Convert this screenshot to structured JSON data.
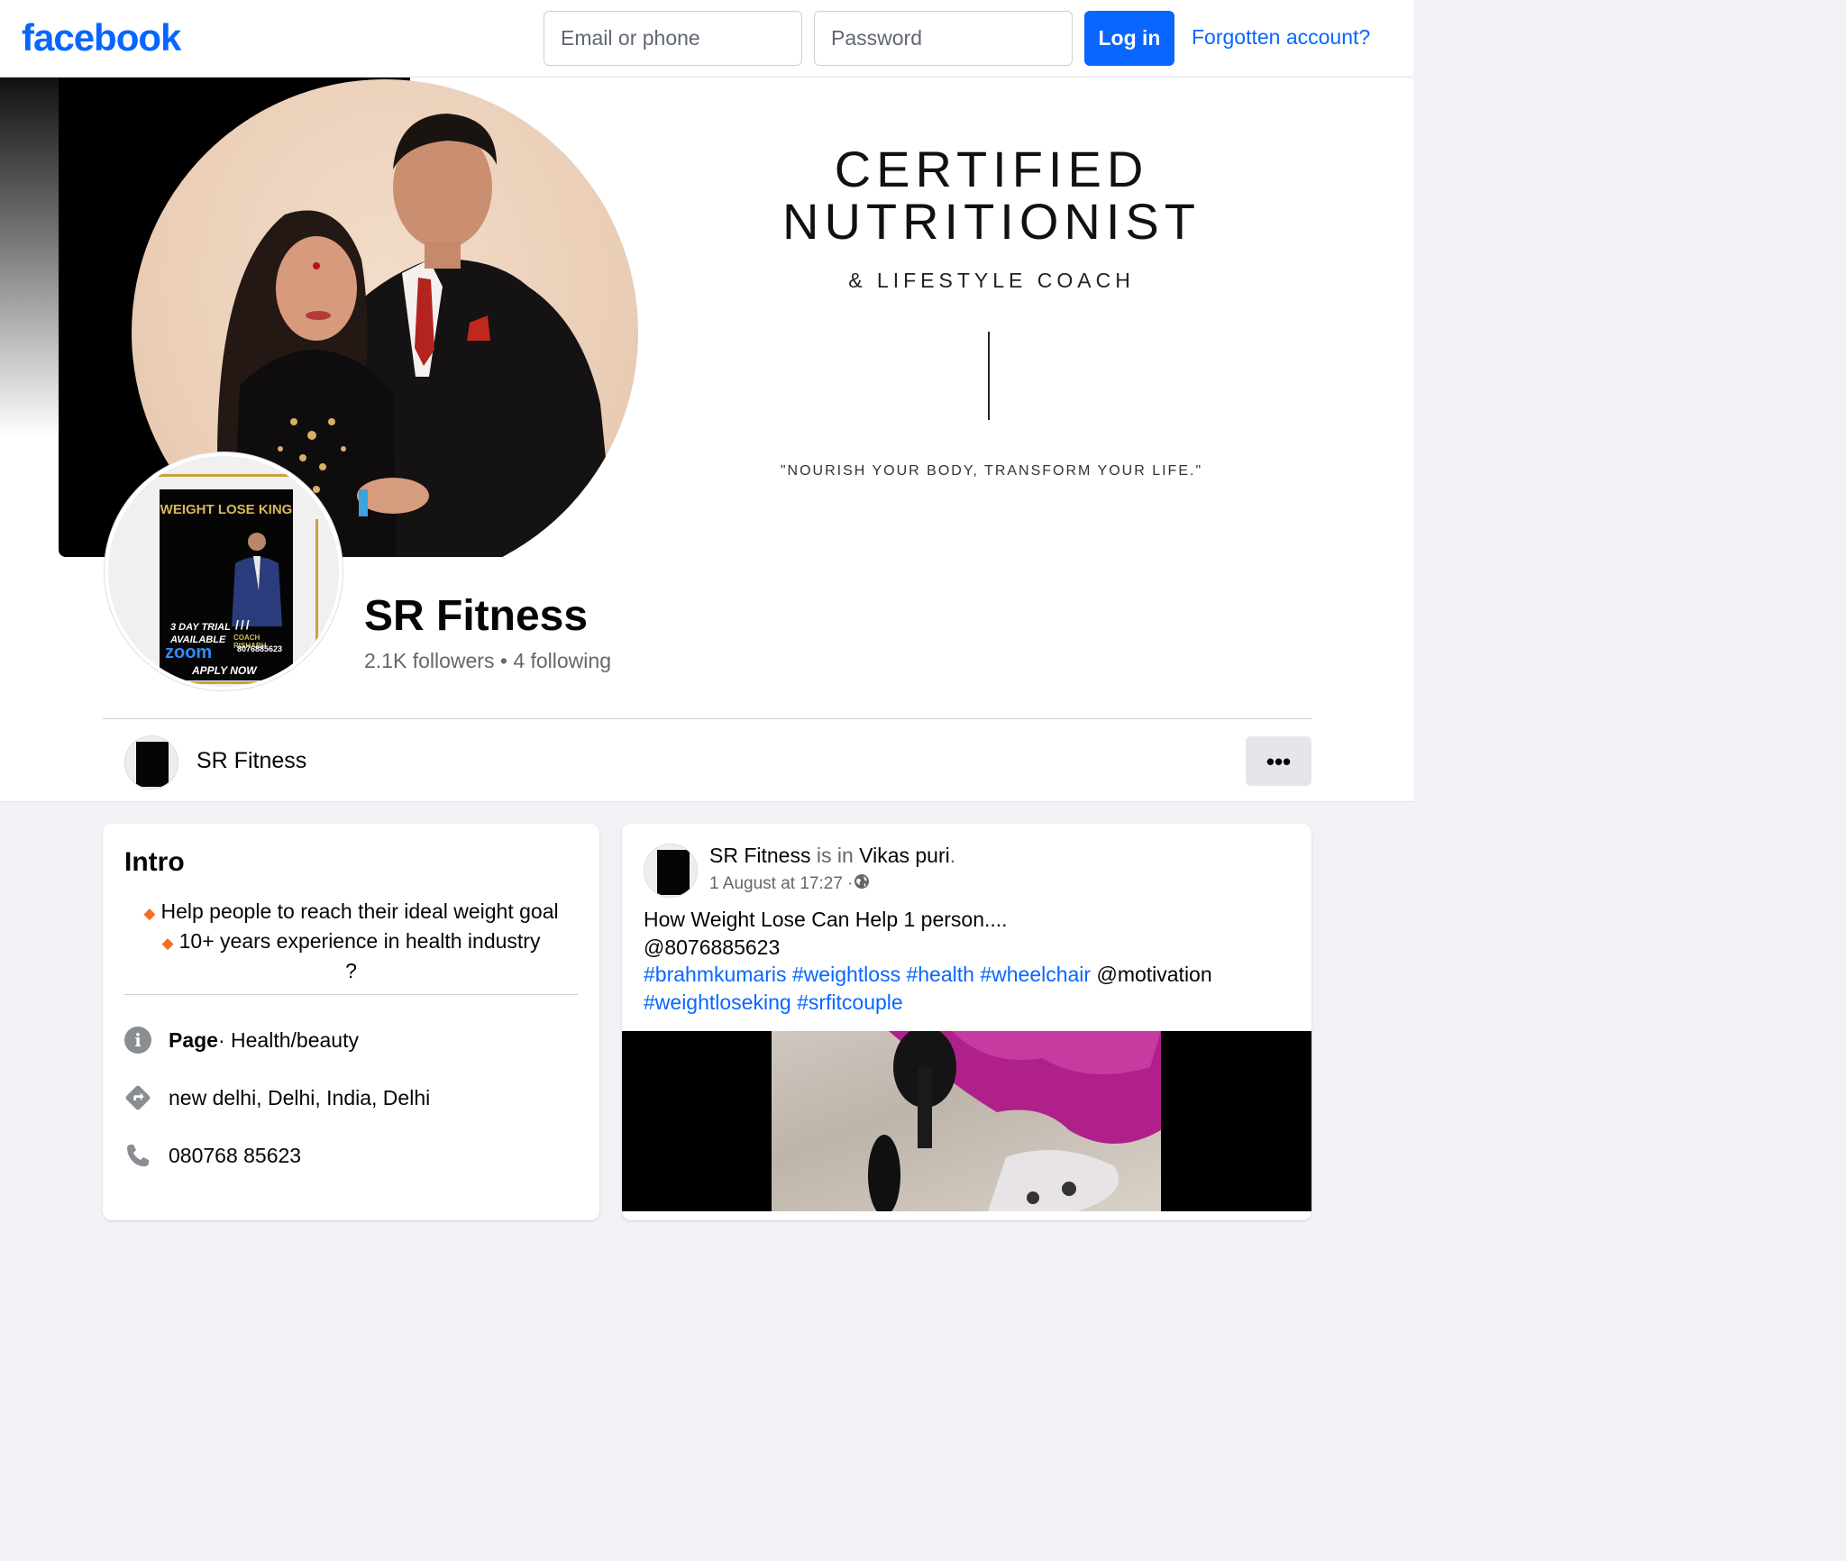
{
  "topbar": {
    "logo": "facebook",
    "email_placeholder": "Email or phone",
    "password_placeholder": "Password",
    "login_label": "Log in",
    "forgot_label": "Forgotten account?"
  },
  "cover": {
    "title_line1": "CERTIFIED",
    "title_line2": "NUTRITIONIST",
    "subtitle": "& LIFESTYLE COACH",
    "quote": "\"NOURISH YOUR BODY, TRANSFORM YOUR LIFE.\""
  },
  "profile_poster": {
    "headline": "WEIGHT LOSE KING",
    "trial_line1": "3 DAY TRIAL",
    "trial_line2": "AVAILABLE",
    "zoom": "zoom",
    "coach": "COACH RISHABH",
    "phone": "8076885623",
    "cta": "APPLY NOW"
  },
  "profile": {
    "name": "SR Fitness",
    "followers": "2.1K followers",
    "following": "4 following",
    "separator": " • "
  },
  "sticky": {
    "name": "SR Fitness",
    "more_label": "•••"
  },
  "intro": {
    "title": "Intro",
    "bio_line1": "Help people to reach their ideal weight goal",
    "bio_line2": "10+ years experience in health industry",
    "bio_line3": "?",
    "page_label": "Page",
    "category": " · Health/beauty",
    "address": "new delhi, Delhi, India, Delhi",
    "phone": "080768 85623"
  },
  "post": {
    "author": "SR Fitness",
    "is_in": " is in ",
    "location": "Vikas puri",
    "period": ".",
    "time": "1 August at 17:27 · ",
    "line1": "How Weight Lose Can Help 1 person....",
    "line2": "@8076885623",
    "tags": [
      "#brahmkumaris",
      "#weightloss",
      "#health",
      "#wheelchair"
    ],
    "mention": "@motivation",
    "tags2": [
      "#weightloseking",
      "#srfitcouple"
    ]
  },
  "colors": {
    "brand": "#0866ff",
    "accent_gold": "#c8a33a",
    "bullet": "#f36f21"
  }
}
